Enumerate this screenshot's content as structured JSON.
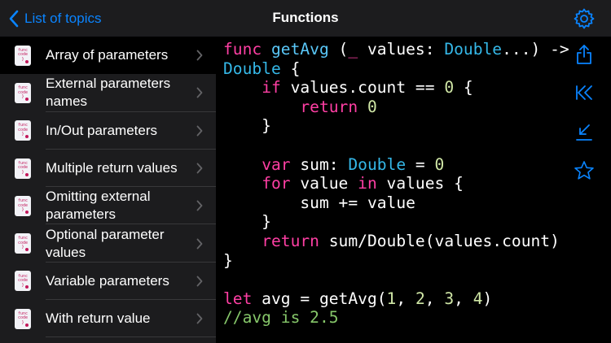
{
  "nav": {
    "back_label": "List of topics",
    "title": "Functions"
  },
  "sidebar": {
    "thumb_lines": [
      "func",
      "code",
      "}"
    ],
    "items": [
      {
        "label": "Array of parameters",
        "selected": true
      },
      {
        "label": "External parameters names",
        "selected": false
      },
      {
        "label": "In/Out parameters",
        "selected": false
      },
      {
        "label": "Multiple return values",
        "selected": false
      },
      {
        "label": "Omitting external parameters",
        "selected": false
      },
      {
        "label": "Optional parameter values",
        "selected": false
      },
      {
        "label": "Variable parameters",
        "selected": false
      },
      {
        "label": "With return value",
        "selected": false
      }
    ]
  },
  "code": {
    "lines": [
      [
        [
          "kw",
          "func"
        ],
        [
          "txt",
          " "
        ],
        [
          "fn",
          "getAvg"
        ],
        [
          "txt",
          " ("
        ],
        [
          "kw",
          "_"
        ],
        [
          "txt",
          " values: "
        ],
        [
          "ty",
          "Double"
        ],
        [
          "txt",
          "...) ->"
        ]
      ],
      [
        [
          "ty",
          "Double"
        ],
        [
          "txt",
          " {"
        ]
      ],
      [
        [
          "txt",
          "    "
        ],
        [
          "kw",
          "if"
        ],
        [
          "txt",
          " values.count == "
        ],
        [
          "nm",
          "0"
        ],
        [
          "txt",
          " {"
        ]
      ],
      [
        [
          "txt",
          "        "
        ],
        [
          "kw",
          "return"
        ],
        [
          "txt",
          " "
        ],
        [
          "nm",
          "0"
        ]
      ],
      [
        [
          "txt",
          "    }"
        ]
      ],
      [
        [
          "txt",
          ""
        ]
      ],
      [
        [
          "txt",
          "    "
        ],
        [
          "kw",
          "var"
        ],
        [
          "txt",
          " sum: "
        ],
        [
          "ty",
          "Double"
        ],
        [
          "txt",
          " = "
        ],
        [
          "nm",
          "0"
        ]
      ],
      [
        [
          "txt",
          "    "
        ],
        [
          "kw",
          "for"
        ],
        [
          "txt",
          " value "
        ],
        [
          "kw",
          "in"
        ],
        [
          "txt",
          " values {"
        ]
      ],
      [
        [
          "txt",
          "        sum += value"
        ]
      ],
      [
        [
          "txt",
          "    }"
        ]
      ],
      [
        [
          "txt",
          "    "
        ],
        [
          "kw",
          "return"
        ],
        [
          "txt",
          " sum/Double(values.count)"
        ]
      ],
      [
        [
          "txt",
          "}"
        ]
      ],
      [
        [
          "txt",
          ""
        ]
      ],
      [
        [
          "kw",
          "let"
        ],
        [
          "txt",
          " avg = getAvg("
        ],
        [
          "nm",
          "1"
        ],
        [
          "txt",
          ", "
        ],
        [
          "nm",
          "2"
        ],
        [
          "txt",
          ", "
        ],
        [
          "nm",
          "3"
        ],
        [
          "txt",
          ", "
        ],
        [
          "nm",
          "4"
        ],
        [
          "txt",
          ")"
        ]
      ],
      [
        [
          "cm",
          "//avg is 2.5"
        ]
      ]
    ]
  },
  "toolbar": {
    "icons": [
      "share-icon",
      "jump-to-start-icon",
      "collapse-icon",
      "favorite-star-icon"
    ]
  },
  "colors": {
    "accent": "#0a84ff",
    "keyword": "#ff3fa4",
    "type": "#35b8e8",
    "number": "#d0e7a6",
    "comment": "#86c76a"
  }
}
